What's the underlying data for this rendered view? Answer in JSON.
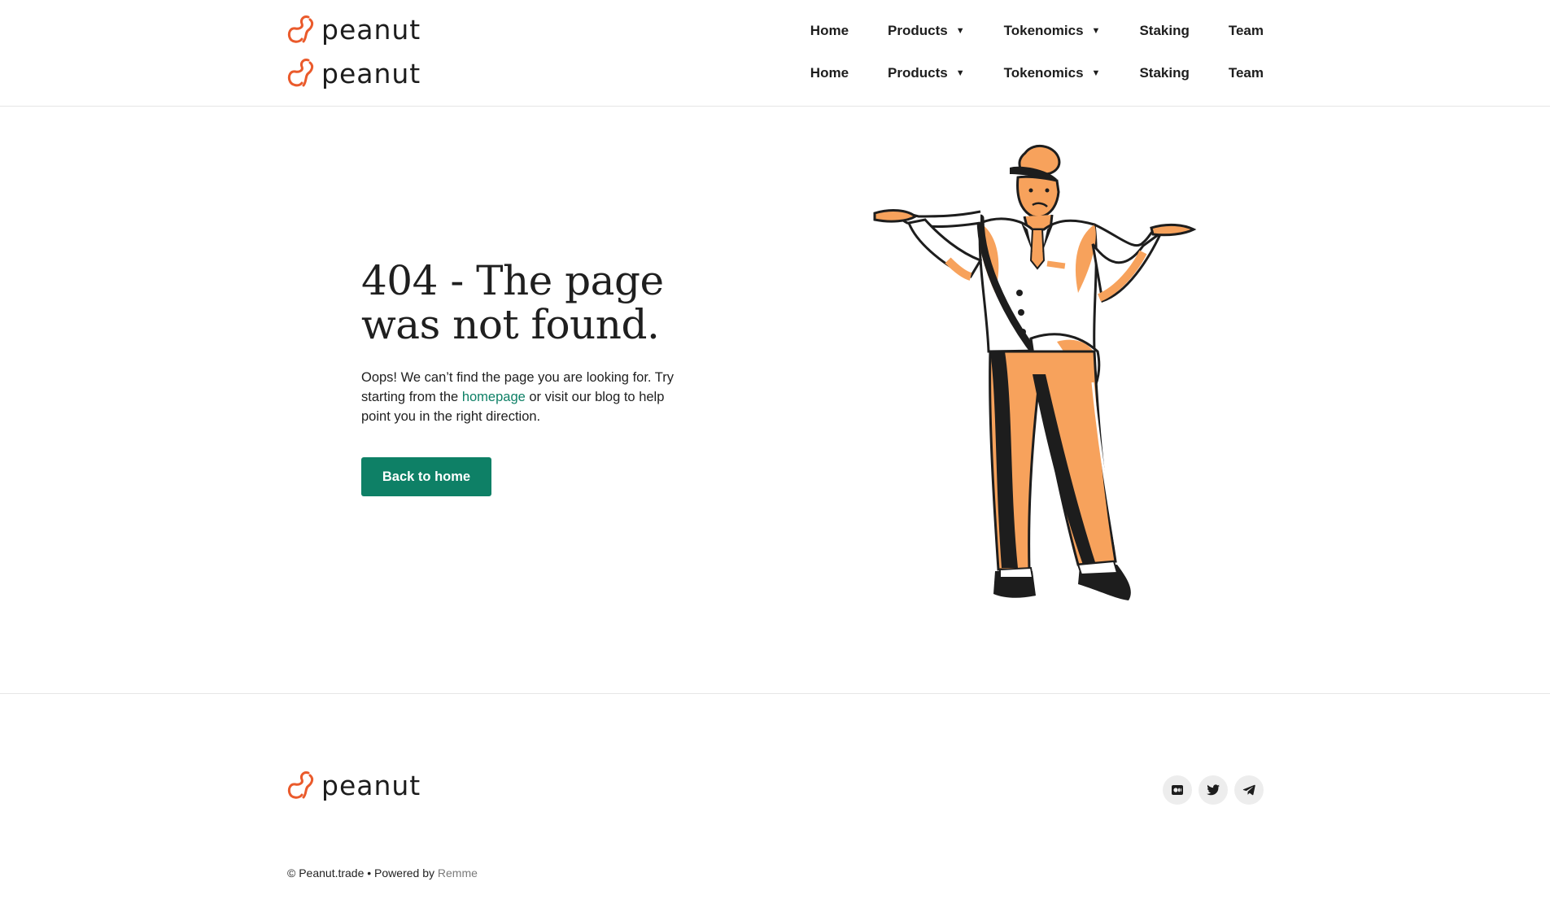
{
  "brand": {
    "name": "peanut",
    "accent": "#ea5a2b",
    "green": "#0e8066"
  },
  "nav": [
    {
      "label": "Home"
    },
    {
      "label": "Products",
      "dropdown": true
    },
    {
      "label": "Tokenomics",
      "dropdown": true
    },
    {
      "label": "Staking"
    },
    {
      "label": "Team"
    }
  ],
  "caret_icon": "caret-down-icon",
  "error": {
    "title": "404 - The page was not found.",
    "message_before": "Oops! We can’t find the page you are looking for. Try starting from the ",
    "link_label": "homepage",
    "message_after": " or visit our blog to help point you in the right direction.",
    "button_label": "Back to home"
  },
  "illustration": "shrugging-mailman-illustration",
  "footer": {
    "social": [
      {
        "icon": "medium-icon"
      },
      {
        "icon": "twitter-icon"
      },
      {
        "icon": "telegram-icon"
      }
    ],
    "copyright": "© Peanut.trade • Powered by ",
    "powered_link": "Remme"
  }
}
